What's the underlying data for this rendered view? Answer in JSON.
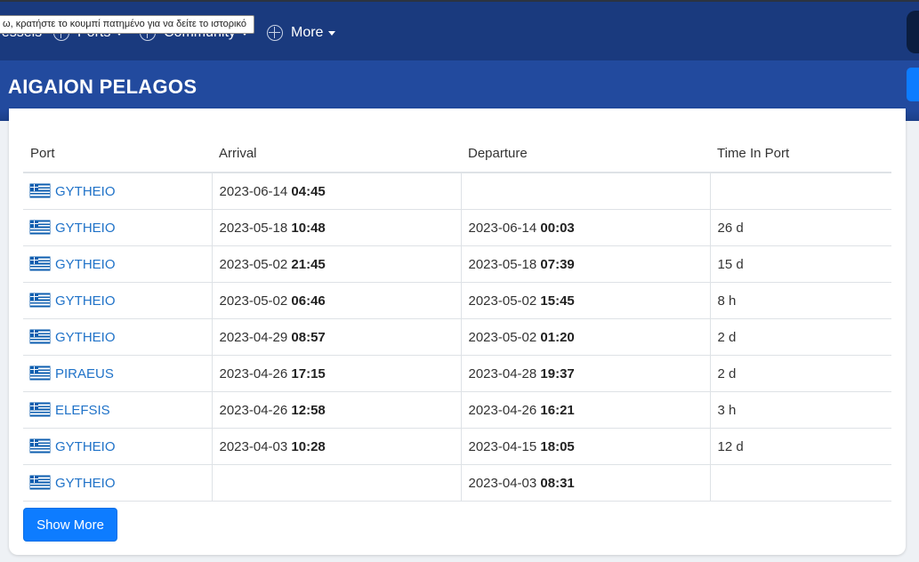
{
  "nav": {
    "items": [
      {
        "label": "Vessels"
      },
      {
        "label": "Ports"
      },
      {
        "label": "Community"
      },
      {
        "label": "More"
      }
    ],
    "tooltip": "ω, κρατήστε το κουμπί πατημένο για να δείτε το ιστορικό"
  },
  "header": {
    "vessel_name": "AIGAION PELAGOS"
  },
  "table": {
    "headers": {
      "port": "Port",
      "arrival": "Arrival",
      "departure": "Departure",
      "time_in_port": "Time In Port"
    },
    "rows": [
      {
        "port": "GYTHEIO",
        "arr_date": "2023-06-14",
        "arr_time": "04:45",
        "dep_date": "",
        "dep_time": "",
        "tip": ""
      },
      {
        "port": "GYTHEIO",
        "arr_date": "2023-05-18",
        "arr_time": "10:48",
        "dep_date": "2023-06-14",
        "dep_time": "00:03",
        "tip": "26 d"
      },
      {
        "port": "GYTHEIO",
        "arr_date": "2023-05-02",
        "arr_time": "21:45",
        "dep_date": "2023-05-18",
        "dep_time": "07:39",
        "tip": "15 d"
      },
      {
        "port": "GYTHEIO",
        "arr_date": "2023-05-02",
        "arr_time": "06:46",
        "dep_date": "2023-05-02",
        "dep_time": "15:45",
        "tip": "8 h"
      },
      {
        "port": "GYTHEIO",
        "arr_date": "2023-04-29",
        "arr_time": "08:57",
        "dep_date": "2023-05-02",
        "dep_time": "01:20",
        "tip": "2 d"
      },
      {
        "port": "PIRAEUS",
        "arr_date": "2023-04-26",
        "arr_time": "17:15",
        "dep_date": "2023-04-28",
        "dep_time": "19:37",
        "tip": "2 d"
      },
      {
        "port": "ELEFSIS",
        "arr_date": "2023-04-26",
        "arr_time": "12:58",
        "dep_date": "2023-04-26",
        "dep_time": "16:21",
        "tip": "3 h"
      },
      {
        "port": "GYTHEIO",
        "arr_date": "2023-04-03",
        "arr_time": "10:28",
        "dep_date": "2023-04-15",
        "dep_time": "18:05",
        "tip": "12 d"
      },
      {
        "port": "GYTHEIO",
        "arr_date": "",
        "arr_time": "",
        "dep_date": "2023-04-03",
        "dep_time": "08:31",
        "tip": ""
      }
    ]
  },
  "show_more_label": "Show More",
  "colors": {
    "nav_bg": "#1a3a7e",
    "header_bg": "#224a9e",
    "link": "#1f72c8",
    "button": "#0d7cff"
  }
}
